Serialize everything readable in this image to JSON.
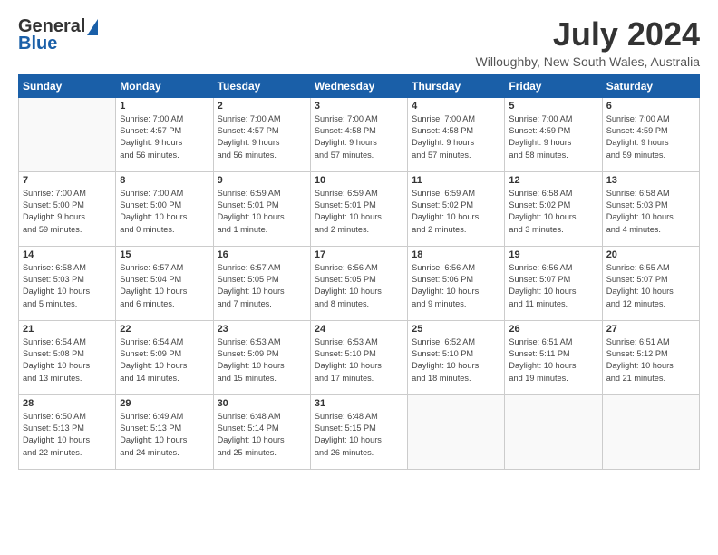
{
  "logo": {
    "general": "General",
    "blue": "Blue"
  },
  "title": {
    "month_year": "July 2024",
    "location": "Willoughby, New South Wales, Australia"
  },
  "days_of_week": [
    "Sunday",
    "Monday",
    "Tuesday",
    "Wednesday",
    "Thursday",
    "Friday",
    "Saturday"
  ],
  "weeks": [
    [
      {
        "day": "",
        "info": ""
      },
      {
        "day": "1",
        "info": "Sunrise: 7:00 AM\nSunset: 4:57 PM\nDaylight: 9 hours\nand 56 minutes."
      },
      {
        "day": "2",
        "info": "Sunrise: 7:00 AM\nSunset: 4:57 PM\nDaylight: 9 hours\nand 56 minutes."
      },
      {
        "day": "3",
        "info": "Sunrise: 7:00 AM\nSunset: 4:58 PM\nDaylight: 9 hours\nand 57 minutes."
      },
      {
        "day": "4",
        "info": "Sunrise: 7:00 AM\nSunset: 4:58 PM\nDaylight: 9 hours\nand 57 minutes."
      },
      {
        "day": "5",
        "info": "Sunrise: 7:00 AM\nSunset: 4:59 PM\nDaylight: 9 hours\nand 58 minutes."
      },
      {
        "day": "6",
        "info": "Sunrise: 7:00 AM\nSunset: 4:59 PM\nDaylight: 9 hours\nand 59 minutes."
      }
    ],
    [
      {
        "day": "7",
        "info": "Sunrise: 7:00 AM\nSunset: 5:00 PM\nDaylight: 9 hours\nand 59 minutes."
      },
      {
        "day": "8",
        "info": "Sunrise: 7:00 AM\nSunset: 5:00 PM\nDaylight: 10 hours\nand 0 minutes."
      },
      {
        "day": "9",
        "info": "Sunrise: 6:59 AM\nSunset: 5:01 PM\nDaylight: 10 hours\nand 1 minute."
      },
      {
        "day": "10",
        "info": "Sunrise: 6:59 AM\nSunset: 5:01 PM\nDaylight: 10 hours\nand 2 minutes."
      },
      {
        "day": "11",
        "info": "Sunrise: 6:59 AM\nSunset: 5:02 PM\nDaylight: 10 hours\nand 2 minutes."
      },
      {
        "day": "12",
        "info": "Sunrise: 6:58 AM\nSunset: 5:02 PM\nDaylight: 10 hours\nand 3 minutes."
      },
      {
        "day": "13",
        "info": "Sunrise: 6:58 AM\nSunset: 5:03 PM\nDaylight: 10 hours\nand 4 minutes."
      }
    ],
    [
      {
        "day": "14",
        "info": "Sunrise: 6:58 AM\nSunset: 5:03 PM\nDaylight: 10 hours\nand 5 minutes."
      },
      {
        "day": "15",
        "info": "Sunrise: 6:57 AM\nSunset: 5:04 PM\nDaylight: 10 hours\nand 6 minutes."
      },
      {
        "day": "16",
        "info": "Sunrise: 6:57 AM\nSunset: 5:05 PM\nDaylight: 10 hours\nand 7 minutes."
      },
      {
        "day": "17",
        "info": "Sunrise: 6:56 AM\nSunset: 5:05 PM\nDaylight: 10 hours\nand 8 minutes."
      },
      {
        "day": "18",
        "info": "Sunrise: 6:56 AM\nSunset: 5:06 PM\nDaylight: 10 hours\nand 9 minutes."
      },
      {
        "day": "19",
        "info": "Sunrise: 6:56 AM\nSunset: 5:07 PM\nDaylight: 10 hours\nand 11 minutes."
      },
      {
        "day": "20",
        "info": "Sunrise: 6:55 AM\nSunset: 5:07 PM\nDaylight: 10 hours\nand 12 minutes."
      }
    ],
    [
      {
        "day": "21",
        "info": "Sunrise: 6:54 AM\nSunset: 5:08 PM\nDaylight: 10 hours\nand 13 minutes."
      },
      {
        "day": "22",
        "info": "Sunrise: 6:54 AM\nSunset: 5:09 PM\nDaylight: 10 hours\nand 14 minutes."
      },
      {
        "day": "23",
        "info": "Sunrise: 6:53 AM\nSunset: 5:09 PM\nDaylight: 10 hours\nand 15 minutes."
      },
      {
        "day": "24",
        "info": "Sunrise: 6:53 AM\nSunset: 5:10 PM\nDaylight: 10 hours\nand 17 minutes."
      },
      {
        "day": "25",
        "info": "Sunrise: 6:52 AM\nSunset: 5:10 PM\nDaylight: 10 hours\nand 18 minutes."
      },
      {
        "day": "26",
        "info": "Sunrise: 6:51 AM\nSunset: 5:11 PM\nDaylight: 10 hours\nand 19 minutes."
      },
      {
        "day": "27",
        "info": "Sunrise: 6:51 AM\nSunset: 5:12 PM\nDaylight: 10 hours\nand 21 minutes."
      }
    ],
    [
      {
        "day": "28",
        "info": "Sunrise: 6:50 AM\nSunset: 5:13 PM\nDaylight: 10 hours\nand 22 minutes."
      },
      {
        "day": "29",
        "info": "Sunrise: 6:49 AM\nSunset: 5:13 PM\nDaylight: 10 hours\nand 24 minutes."
      },
      {
        "day": "30",
        "info": "Sunrise: 6:48 AM\nSunset: 5:14 PM\nDaylight: 10 hours\nand 25 minutes."
      },
      {
        "day": "31",
        "info": "Sunrise: 6:48 AM\nSunset: 5:15 PM\nDaylight: 10 hours\nand 26 minutes."
      },
      {
        "day": "",
        "info": ""
      },
      {
        "day": "",
        "info": ""
      },
      {
        "day": "",
        "info": ""
      }
    ]
  ]
}
